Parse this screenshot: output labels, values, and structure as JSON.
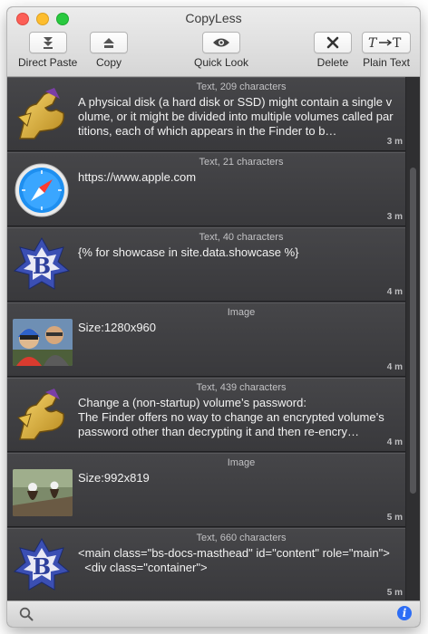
{
  "window": {
    "title": "CopyLess"
  },
  "toolbar": {
    "direct_paste": "Direct Paste",
    "copy": "Copy",
    "quick_look": "Quick Look",
    "delete": "Delete",
    "plain_text": "Plain Text"
  },
  "clips": [
    {
      "meta": "Text, 209 characters",
      "text": "A physical disk (a hard disk or SSD) might contain a single volume, or it might be divided into multiple volumes called partitions, each of which appears in the Finder to b…",
      "time": "3 m",
      "icon": "muscle-arm-app-icon"
    },
    {
      "meta": "Text, 21 characters",
      "text": "https://www.apple.com",
      "time": "3 m",
      "icon": "safari-icon"
    },
    {
      "meta": "Text, 40 characters",
      "text": "{% for showcase in site.data.showcase %}",
      "time": "4 m",
      "icon": "bbedit-icon"
    },
    {
      "meta": "Image",
      "text": "Size:1280x960",
      "time": "4 m",
      "icon": "photo-thumbnail"
    },
    {
      "meta": "Text, 439 characters",
      "text": "Change a (non-startup) volume’s password:\nThe Finder offers no way to change an encrypted volume’s password other than decrypting it and then re-encry…",
      "time": "4 m",
      "icon": "muscle-arm-app-icon"
    },
    {
      "meta": "Image",
      "text": "Size:992x819",
      "time": "5 m",
      "icon": "photo-thumbnail"
    },
    {
      "meta": "Text, 660 characters",
      "text": "<main class=\"bs-docs-masthead\" id=\"content\" role=\"main\">\n  <div class=\"container\">",
      "time": "5 m",
      "icon": "bbedit-icon"
    }
  ]
}
